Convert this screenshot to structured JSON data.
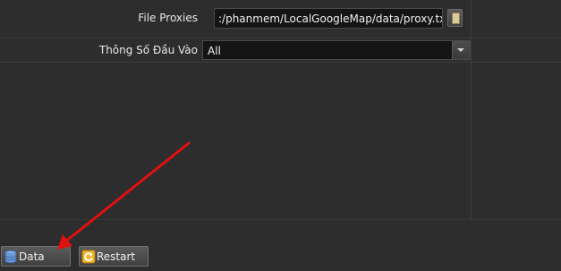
{
  "form": {
    "proxies": {
      "label": "File Proxies",
      "value": ":/phanmem/LocalGoogleMap/data/proxy.txt"
    },
    "params": {
      "label": "Thông Số Đầu Vào",
      "selected": "All"
    }
  },
  "footer": {
    "data_label": "Data",
    "restart_label": "Restart"
  },
  "icons": {
    "browse": "file-icon",
    "data": "database-icon",
    "restart": "refresh-icon"
  },
  "colors": {
    "background": "#2d2d2d",
    "annotation": "#e01010"
  }
}
